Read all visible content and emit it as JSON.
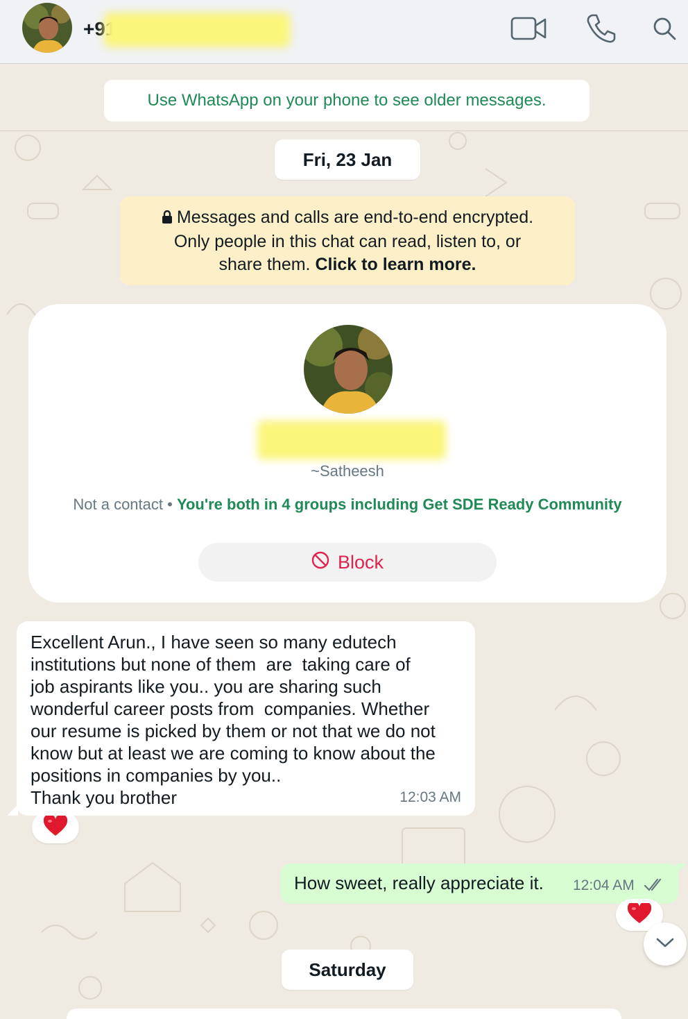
{
  "header": {
    "phone_prefix": "+91",
    "icons": [
      "video-call-icon",
      "voice-call-icon",
      "search-icon"
    ]
  },
  "chat": {
    "older_messages": "Use WhatsApp on your phone to see older messages.",
    "date_1": "Fri, 23 Jan",
    "encryption": {
      "line1": "Messages and calls are end-to-end encrypted.",
      "line2": "Only people in this chat can read, listen to, or",
      "line3_plain": "share them. ",
      "line3_bold": "Click to learn more."
    },
    "contact_card": {
      "alias": "~Satheesh",
      "not_contact": "Not a contact",
      "separator": " • ",
      "groups": "You're both in 4 groups including Get SDE Ready Community",
      "block_label": "Block"
    },
    "incoming": {
      "lines": [
        "Excellent Arun., I have seen so many edutech",
        "institutions but none of them  are  taking care of",
        "job aspirants like you.. you are sharing such",
        "wonderful career posts from  companies. Whether",
        "our resume is picked by them or not that we do not",
        "know but at least we are coming to know about the",
        "positions in companies by you..",
        "Thank you brother"
      ],
      "time": "12:03 AM",
      "reaction": "❤️"
    },
    "outgoing": {
      "text": "How sweet, really appreciate it.",
      "time": "12:04 AM",
      "reaction": "❤️"
    },
    "date_2": "Saturday"
  },
  "colors": {
    "accent_green": "#1f8a55",
    "block_red": "#e0234e",
    "outgoing_bubble": "#d9fdd3",
    "encryption_bg": "#fdf0c8"
  }
}
